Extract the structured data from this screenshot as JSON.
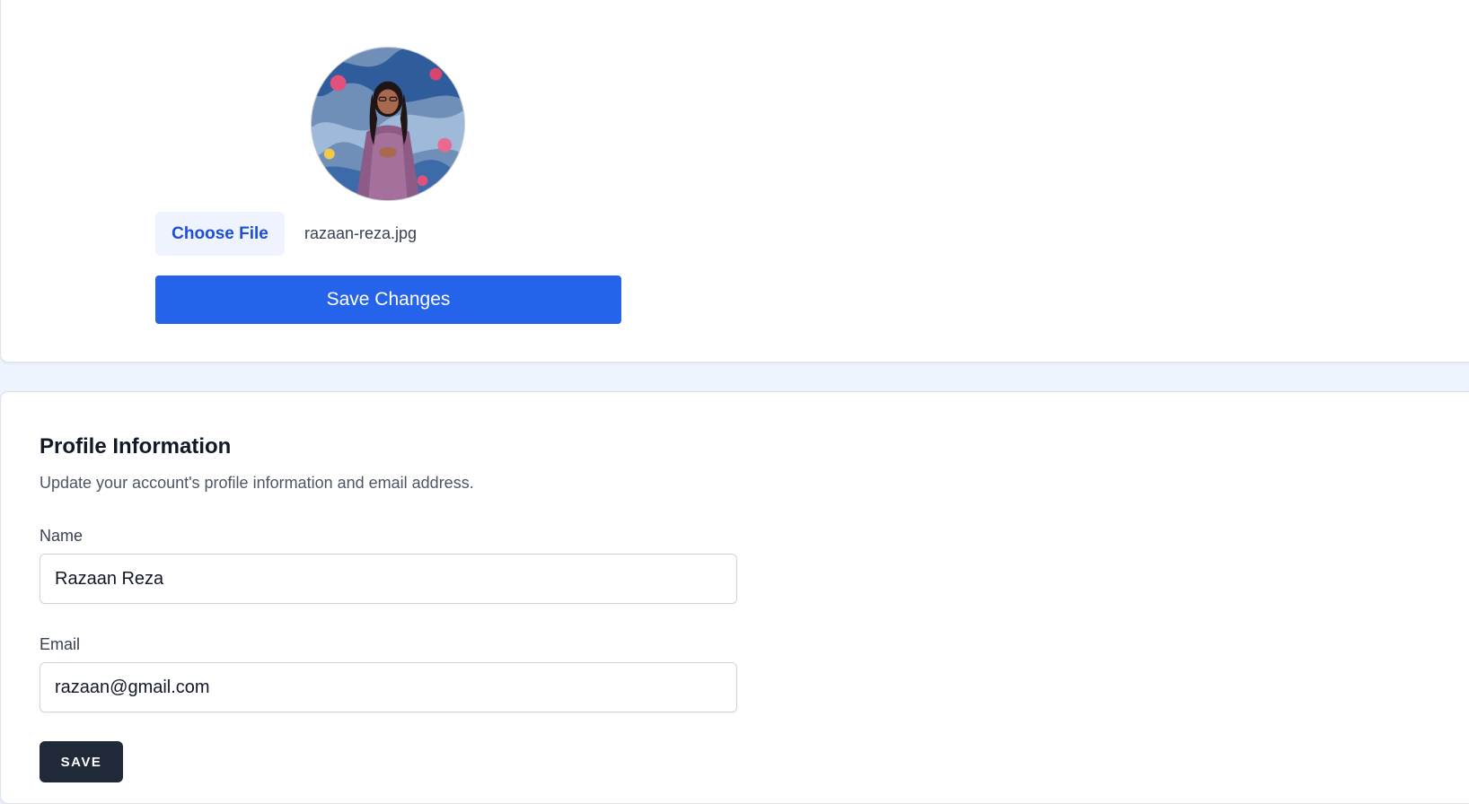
{
  "photo": {
    "choose_file_label": "Choose File",
    "file_name": "razaan-reza.jpg",
    "save_changes_label": "Save Changes"
  },
  "profile": {
    "title": "Profile Information",
    "description": "Update your account's profile information and email address.",
    "name_label": "Name",
    "name_value": "Razaan Reza",
    "email_label": "Email",
    "email_value": "razaan@gmail.com",
    "save_label": "SAVE"
  },
  "colors": {
    "page_bg": "#eef4fd",
    "primary_button": "#2563eb",
    "file_button_text": "#1d4ed8",
    "save_button": "#1f2937"
  }
}
